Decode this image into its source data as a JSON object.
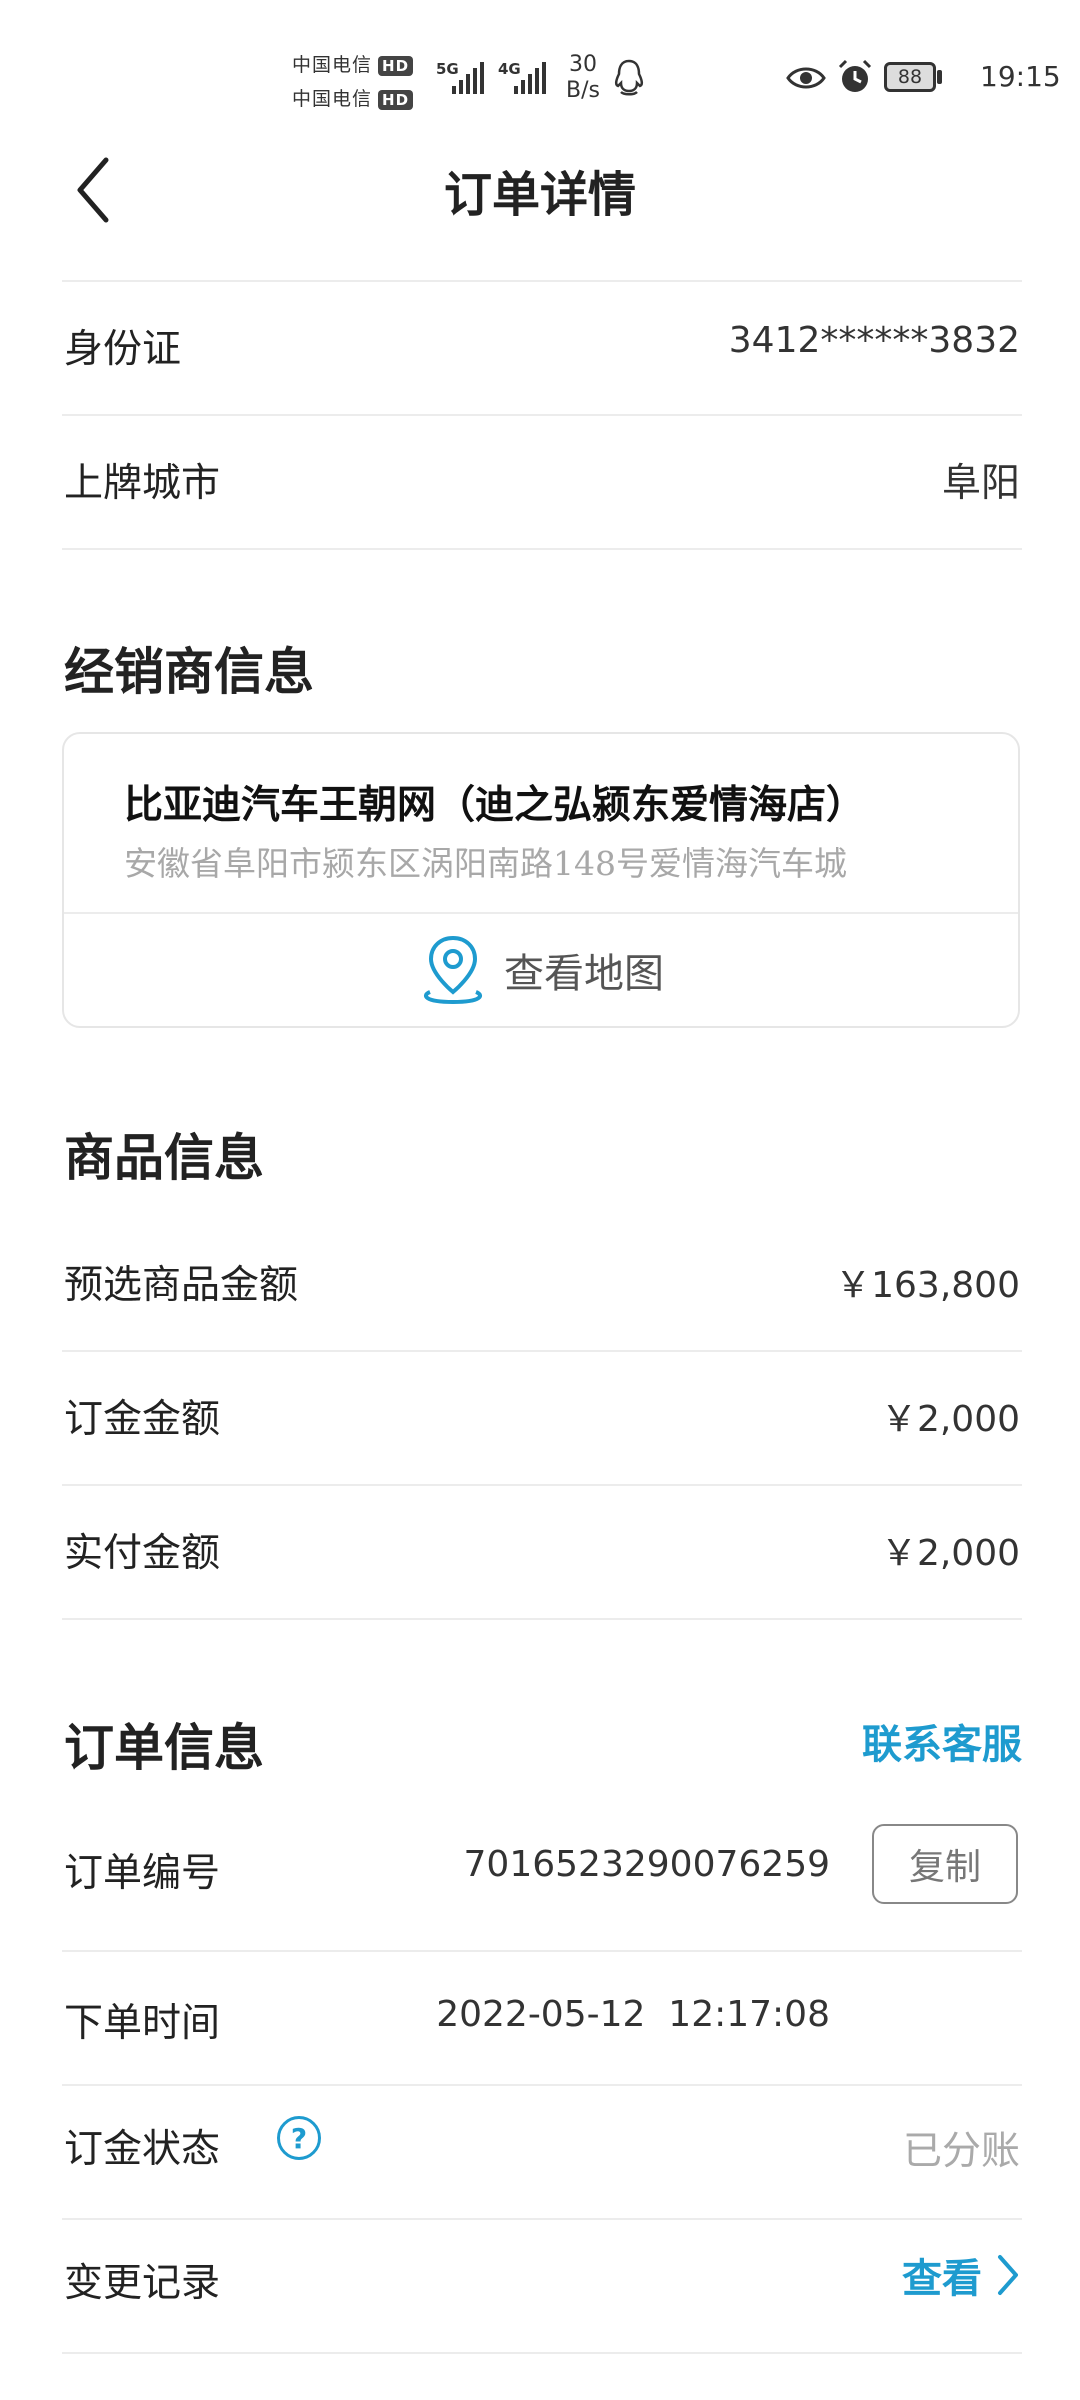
{
  "status_bar": {
    "carrier1": "中国电信",
    "carrier2": "中国电信",
    "hd": "HD",
    "net1": "5G",
    "net2": "4G",
    "speed_value": "30",
    "speed_unit": "B/s",
    "battery": "88",
    "time": "19:15"
  },
  "header": {
    "title": "订单详情"
  },
  "buyer": {
    "id_label": "身份证",
    "id_value": "3412******3832",
    "city_label": "上牌城市",
    "city_value": "阜阳"
  },
  "dealer": {
    "section_title": "经销商信息",
    "name": "比亚迪汽车王朝网（迪之弘颍东爱情海店）",
    "address": "安徽省阜阳市颍东区涡阳南路148号爱情海汽车城",
    "map_label": "查看地图"
  },
  "goods": {
    "section_title": "商品信息",
    "rows": [
      {
        "label": "预选商品金额",
        "value": "￥163,800"
      },
      {
        "label": "订金金额",
        "value": "￥2,000"
      },
      {
        "label": "实付金额",
        "value": "￥2,000"
      }
    ]
  },
  "order": {
    "section_title": "订单信息",
    "contact": "联系客服",
    "number_label": "订单编号",
    "number_value": "7016523290076259",
    "copy": "复制",
    "time_label": "下单时间",
    "time_value": "2022-05-12  12:17:08",
    "deposit_label": "订金状态",
    "help": "?",
    "deposit_value": "已分账",
    "change_label": "变更记录",
    "change_link": "查看"
  },
  "colors": {
    "accent": "#1e9bcf"
  }
}
